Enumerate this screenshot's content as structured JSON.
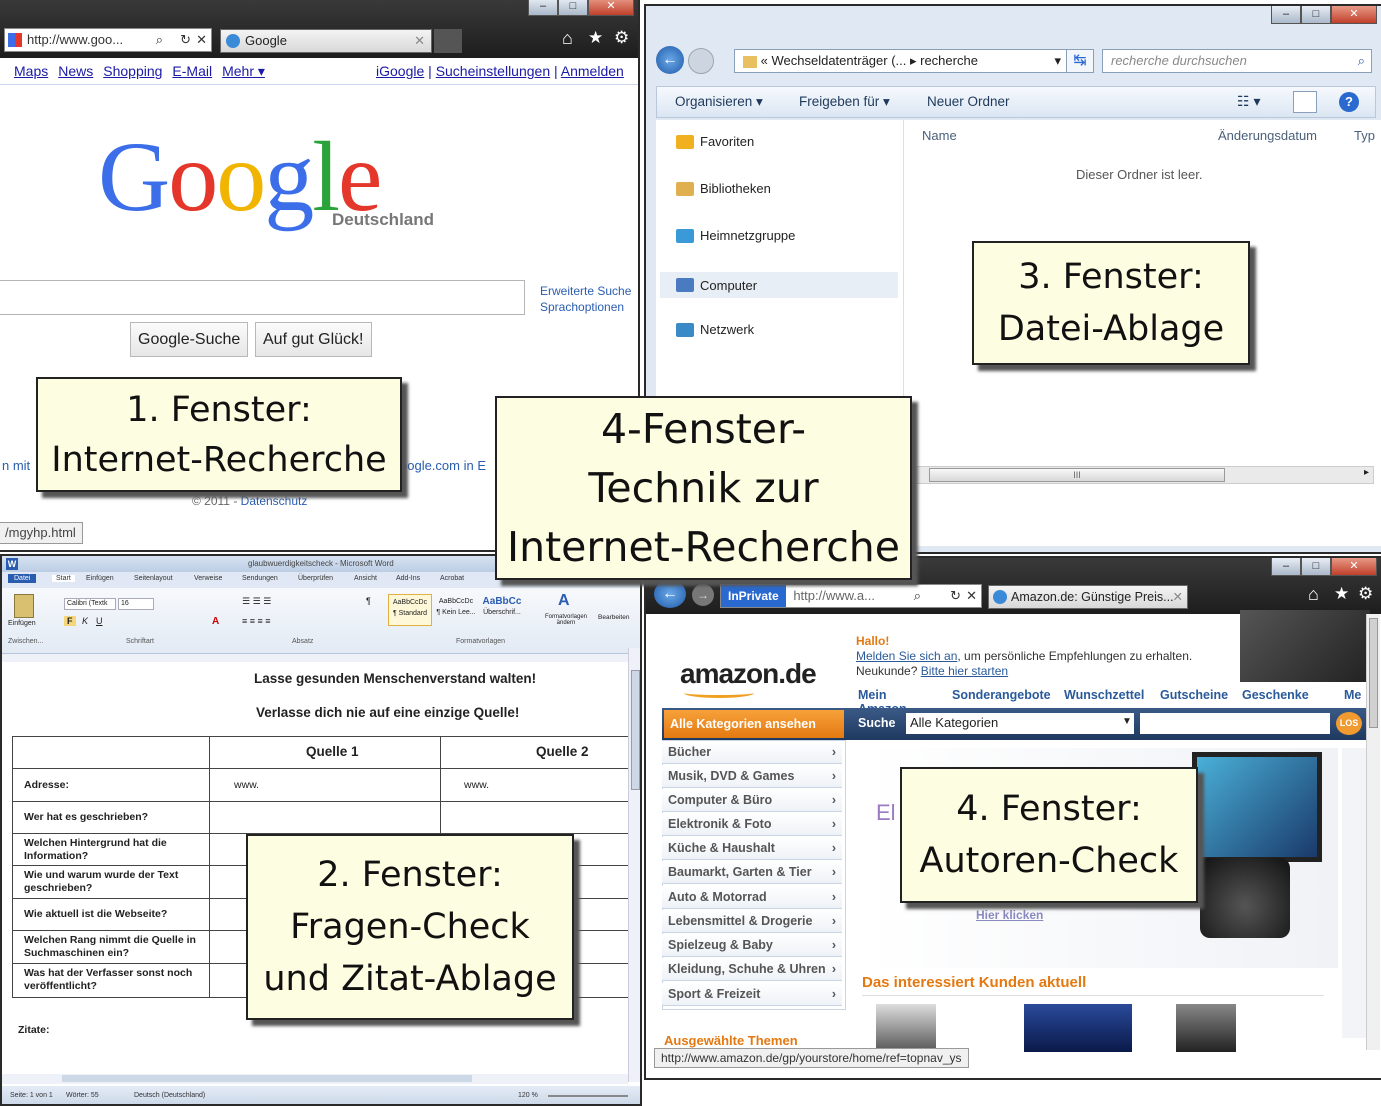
{
  "google_window": {
    "address": "http://www.goo...",
    "tab_label": "Google",
    "top_links": [
      "Maps",
      "News",
      "Shopping",
      "E-Mail",
      "Mehr ▾"
    ],
    "right_links": [
      "iGoogle",
      "Sucheinstellungen",
      "Anmelden"
    ],
    "logo_letters": [
      "G",
      "o",
      "o",
      "g",
      "l",
      "e"
    ],
    "logo_colors": [
      "#3b6ee8",
      "#e5362b",
      "#f1b400",
      "#3b6ee8",
      "#2aa43a",
      "#e5362b"
    ],
    "logo_sub": "Deutschland",
    "advanced_search": "Erweiterte Suche",
    "language_options": "Sprachoptionen",
    "search_button": "Google-Suche",
    "lucky_button": "Auf gut Glück!",
    "footer_left": "n mit",
    "footer_right": "oogle.com in E",
    "copyright": "© 2011 - ",
    "privacy_link": "Datenschutz",
    "status_url": "/mgyhp.html"
  },
  "explorer_window": {
    "breadcrumb_prefix": "«",
    "breadcrumb_drive": "Wechseldatenträger (...",
    "breadcrumb_folder": "recherche",
    "search_placeholder": "recherche durchsuchen",
    "toolbar": [
      "Organisieren ▾",
      "Freigeben für ▾",
      "Neuer Ordner"
    ],
    "nav": [
      {
        "label": "Favoriten",
        "color": "#f0b020"
      },
      {
        "label": "Bibliotheken",
        "color": "#e0b050"
      },
      {
        "label": "Heimnetzgruppe",
        "color": "#3a9ad8"
      },
      {
        "label": "Computer",
        "color": "#4a7ac0"
      },
      {
        "label": "Netzwerk",
        "color": "#3a8ac8"
      }
    ],
    "columns": [
      "Name",
      "Änderungsdatum",
      "Typ"
    ],
    "empty_message": "Dieser Ordner ist leer.",
    "scroll_grip": "III"
  },
  "word_window": {
    "title": "glaubwuerdigkeitscheck - Microsoft Word",
    "tabs": [
      "Datei",
      "Start",
      "Einfügen",
      "Seitenlayout",
      "Verweise",
      "Sendungen",
      "Überprüfen",
      "Ansicht",
      "Add-Ins",
      "Acrobat"
    ],
    "font_name": "Calibri (Textk",
    "font_size": "16",
    "paste_label": "Einfügen",
    "styles": [
      {
        "preview": "AaBbCcDc",
        "name": "¶ Standard"
      },
      {
        "preview": "AaBbCcDc",
        "name": "¶ Kein Lee..."
      },
      {
        "preview": "AaBbCc",
        "name": "Überschrif..."
      }
    ],
    "change_styles": "Formatvorlagen ändern",
    "edit_label": "Bearbeiten",
    "groups": [
      "Zwischen...",
      "Schriftart",
      "Absatz",
      "Formatvorlagen"
    ],
    "heading1": "Lasse gesunden Menschenverstand walten!",
    "heading2": "Verlasse dich nie auf eine einzige Quelle!",
    "col_headers": [
      "Quelle 1",
      "Quelle 2"
    ],
    "rows": [
      {
        "label": "Adresse:",
        "v1": "www.",
        "v2": "www."
      },
      {
        "label": "Wer hat es geschrieben?",
        "v1": "",
        "v2": ""
      },
      {
        "label": "Welchen Hintergrund hat die Information?",
        "v1": "",
        "v2": ""
      },
      {
        "label": "Wie und warum wurde der Text geschrieben?",
        "v1": "",
        "v2": ""
      },
      {
        "label": "Wie aktuell ist die Webseite?",
        "v1": "",
        "v2": ""
      },
      {
        "label": "Welchen Rang nimmt die Quelle in Suchmaschinen ein?",
        "v1": "",
        "v2": ""
      },
      {
        "label": "Was hat der Verfasser sonst noch veröffentlicht?",
        "v1": "",
        "v2": ""
      }
    ],
    "quotes_label": "Zitate:",
    "status": [
      "Seite: 1 von 1",
      "Wörter: 55",
      "Deutsch (Deutschland)"
    ],
    "zoom": "120 %"
  },
  "amazon_window": {
    "inprivate": "InPrivate",
    "address": "http://www.a...",
    "tab_label": "Amazon.de: Günstige Preis...",
    "logo": "amazon.de",
    "hello": "Hallo!",
    "signin_link": "Melden Sie sich an",
    "signin_text": ", um persönliche Empfehlungen zu erhalten.",
    "new_customer": "Neukunde? ",
    "start_link": "Bitte hier starten",
    "subnav": [
      "Mein Amazon",
      "Sonderangebote",
      "Wunschzettel",
      "Gutscheine",
      "Geschenke",
      "Me"
    ],
    "categories_button": "Alle Kategorien ansehen",
    "search_label": "Suche",
    "search_select": "Alle Kategorien",
    "go_button": "LOS",
    "categories": [
      "Bücher",
      "Musik, DVD & Games",
      "Computer & Büro",
      "Elektronik & Foto",
      "Küche & Haushalt",
      "Baumarkt, Garten & Tier",
      "Auto & Motorrad",
      "Lebensmittel & Drogerie",
      "Spielzeug & Baby",
      "Kleidung, Schuhe & Uhren",
      "Sport & Freizeit"
    ],
    "banner_text": "El",
    "click_here": "Hier klicken",
    "interest_heading": "Das interessiert Kunden aktuell",
    "themes_heading": "Ausgewählte Themen",
    "status_url": "http://www.amazon.de/gp/yourstore/home/ref=topnav_ys",
    "chevron": "›"
  },
  "notes": {
    "window1": [
      "1. Fenster:",
      "Internet-Recherche"
    ],
    "window2": [
      "2. Fenster:",
      "Fragen-Check",
      "und Zitat-Ablage"
    ],
    "window3": [
      "3. Fenster:",
      "Datei-Ablage"
    ],
    "window4": [
      "4. Fenster:",
      "Autoren-Check"
    ],
    "center": [
      "4-Fenster-",
      "Technik zur",
      "Internet-Recherche"
    ]
  },
  "window_controls": {
    "minimize": "–",
    "maximize": "□",
    "close": "✕"
  }
}
